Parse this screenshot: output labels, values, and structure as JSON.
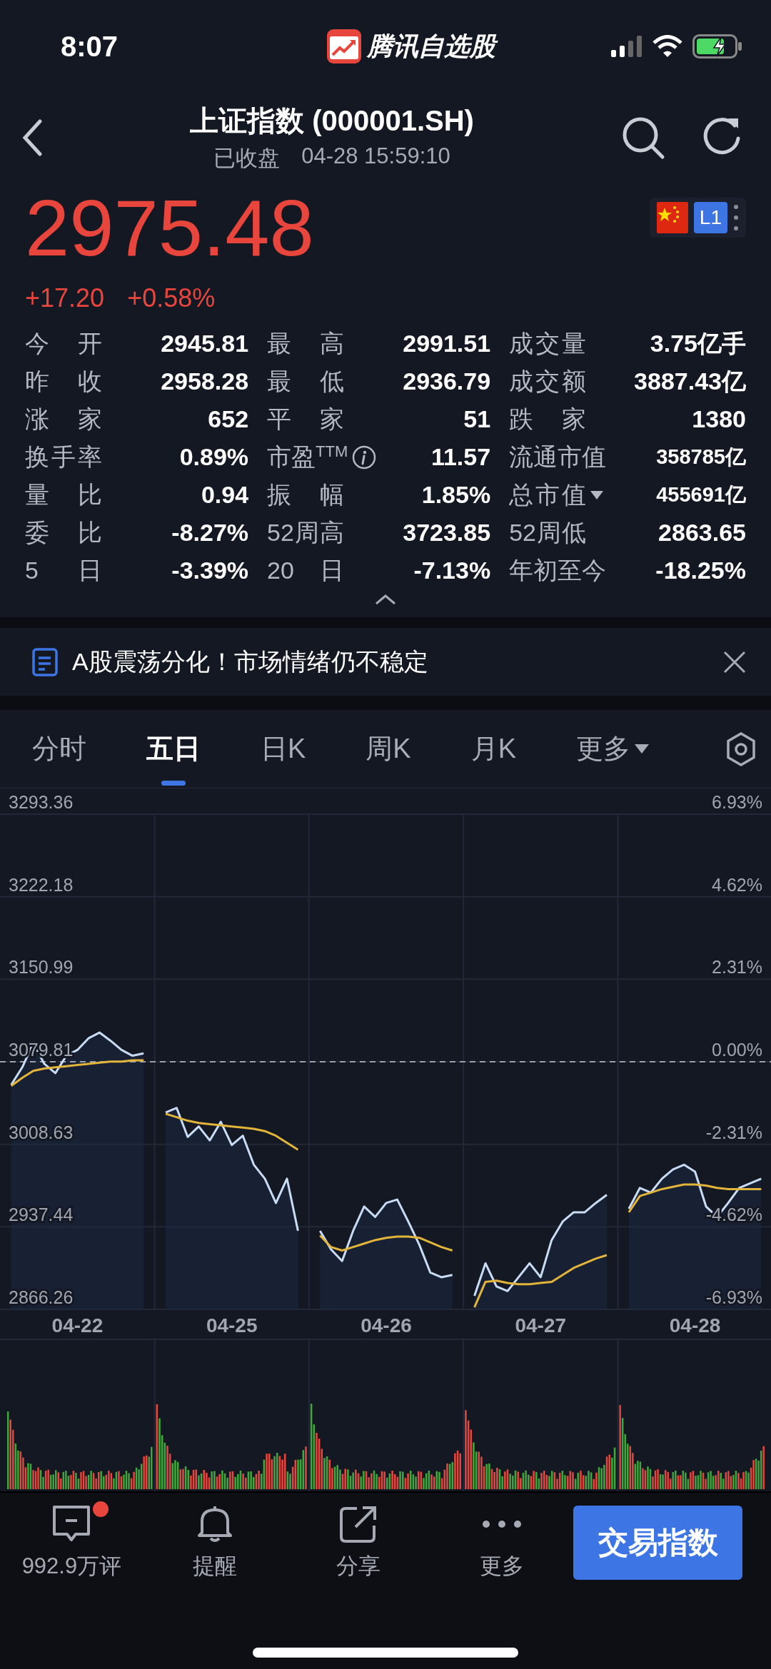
{
  "status_bar": {
    "time": "8:07",
    "app_name": "腾讯自选股"
  },
  "header": {
    "title": "上证指数 (000001.SH)",
    "status": "已收盘",
    "timestamp": "04-28 15:59:10"
  },
  "quote": {
    "price": "2975.48",
    "change": "+17.20",
    "change_percent": "+0.58%",
    "level_badge": "L1"
  },
  "stats": [
    {
      "label": "今 开",
      "value": "2945.81",
      "kind": "plain"
    },
    {
      "label": "最 高",
      "value": "2991.51",
      "kind": "plain"
    },
    {
      "label": "成交量",
      "value": "3.75亿手",
      "kind": "plain"
    },
    {
      "label": "昨 收",
      "value": "2958.28",
      "kind": "plain"
    },
    {
      "label": "最 低",
      "value": "2936.79",
      "kind": "plain"
    },
    {
      "label": "成交额",
      "value": "3887.43亿",
      "kind": "plain"
    },
    {
      "label": "涨 家",
      "value": "652",
      "kind": "plain"
    },
    {
      "label": "平 家",
      "value": "51",
      "kind": "plain"
    },
    {
      "label": "跌 家",
      "value": "1380",
      "kind": "plain"
    },
    {
      "label": "换手率",
      "value": "0.89%",
      "kind": "plain"
    },
    {
      "label": "市盈$^{TTM}$",
      "value": "11.57",
      "kind": "info"
    },
    {
      "label": "流通市值",
      "value": "358785亿",
      "kind": "compact"
    },
    {
      "label": "量 比",
      "value": "0.94",
      "kind": "plain"
    },
    {
      "label": "振 幅",
      "value": "1.85%",
      "kind": "plain"
    },
    {
      "label": "总市值",
      "value": "455691亿",
      "kind": "dropdown"
    },
    {
      "label": "委 比",
      "value": "-8.27%",
      "kind": "plain"
    },
    {
      "label": "52周高",
      "value": "3723.85",
      "kind": "plain"
    },
    {
      "label": "52周低",
      "value": "2863.65",
      "kind": "plain"
    },
    {
      "label": "5 日",
      "value": "-3.39%",
      "kind": "plain"
    },
    {
      "label": "20 日",
      "value": "-7.13%",
      "kind": "plain"
    },
    {
      "label": "年初至今",
      "value": "-18.25%",
      "kind": "plain"
    }
  ],
  "news": {
    "headline": "A股震荡分化！市场情绪仍不稳定"
  },
  "chart_tabs": [
    {
      "label": "分时",
      "selected": false,
      "kind": "period"
    },
    {
      "label": "五日",
      "selected": true,
      "kind": "period"
    },
    {
      "label": "日K",
      "selected": false,
      "kind": "period"
    },
    {
      "label": "周K",
      "selected": false,
      "kind": "period"
    },
    {
      "label": "月K",
      "selected": false,
      "kind": "period"
    },
    {
      "label": "更多",
      "selected": false,
      "kind": "menu"
    }
  ],
  "chart": {
    "percent_labels": [
      "6.93%",
      "4.62%",
      "2.31%",
      "0.00%",
      "-2.31%",
      "-4.62%",
      "-6.93%"
    ],
    "chart_data": {
      "type": "line",
      "categories": [
        null,
        null,
        null,
        null,
        null,
        null,
        "04-22",
        null,
        null,
        null,
        null,
        null,
        null,
        null,
        null,
        null,
        null,
        null,
        null,
        null,
        "04-25",
        null,
        null,
        null,
        null,
        null,
        null,
        null,
        null,
        null,
        null,
        null,
        null,
        null,
        "04-26",
        null,
        null,
        null,
        null,
        null,
        null,
        null,
        null,
        null,
        null,
        null,
        null,
        null,
        "04-27",
        null,
        null,
        null,
        null,
        null,
        null,
        null,
        null,
        null,
        null,
        null,
        null,
        null,
        "04-28",
        null,
        null,
        null,
        null,
        null,
        null
      ],
      "series": [
        {
          "color": "#c9dcf5",
          "values": [
            3060,
            3075,
            3096,
            3078,
            3070,
            3085,
            3090,
            3100,
            3105,
            3098,
            3090,
            3085,
            3087,
            null,
            3036,
            3040,
            3015,
            3024,
            3012,
            3028,
            3008,
            3016,
            2991,
            2979,
            2958,
            2979,
            2934,
            null,
            2934,
            2918,
            2908,
            2934,
            2955,
            2946,
            2958,
            2961,
            2942,
            2922,
            2898,
            2894,
            2896,
            null,
            2878,
            2906,
            2886,
            2882,
            2894,
            2906,
            2894,
            2926,
            2942,
            2950,
            2950,
            2958,
            2965,
            null,
            2953,
            2971,
            2967,
            2979,
            2987,
            2991,
            2985,
            2955,
            2946,
            2958,
            2971,
            2975,
            2979
          ]
        },
        {
          "color": "#e2b53a",
          "values": [
            3059,
            3066,
            3072,
            3074,
            3075,
            3076,
            3077,
            3078,
            3079,
            3080,
            3080,
            3081,
            3081,
            null,
            3035,
            3032,
            3029,
            3027,
            3026,
            3025,
            3024,
            3023,
            3022,
            3020,
            3016,
            3010,
            3004,
            null,
            2930,
            2920,
            2917,
            2920,
            2923,
            2926,
            2928,
            2929,
            2929,
            2928,
            2924,
            2920,
            2917,
            null,
            2868,
            2890,
            2891,
            2889,
            2888,
            2888,
            2889,
            2890,
            2896,
            2902,
            2906,
            2910,
            2913,
            null,
            2950,
            2964,
            2967,
            2970,
            2972,
            2974,
            2974,
            2973,
            2971,
            2970,
            2970,
            2970,
            2970
          ]
        }
      ],
      "ylim": [
        2866.26,
        3293.36
      ],
      "yticks": [
        2866.26,
        2937.44,
        3008.63,
        3079.81,
        3150.99,
        3222.18,
        3293.36
      ],
      "grid": true,
      "ref_lines": [
        {
          "axis": "y",
          "value": 3079.81
        }
      ]
    }
  },
  "bottom_bar": {
    "actions": [
      {
        "label": "992.9万评",
        "unread": true
      },
      {
        "label": "提醒",
        "unread": false
      },
      {
        "label": "分享",
        "unread": false
      },
      {
        "label": "更多",
        "unread": false
      }
    ],
    "trade_button": "交易指数"
  }
}
